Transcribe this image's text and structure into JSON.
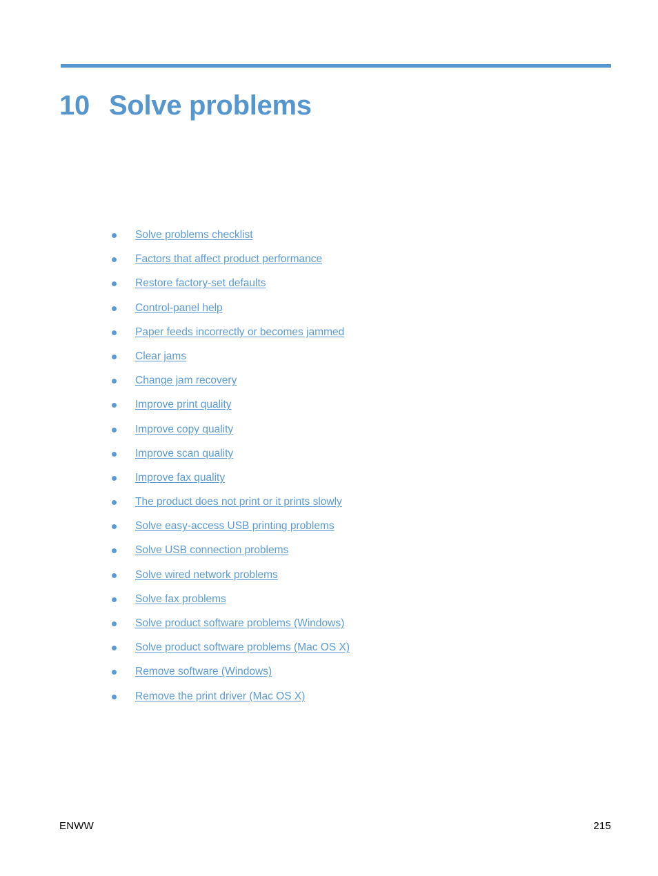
{
  "page": {
    "background_color": "#ffffff",
    "accent_color": "#5496cd",
    "link_color": "#5b9bd5"
  },
  "chapter": {
    "number": "10",
    "title": "Solve problems"
  },
  "toc": {
    "items": [
      {
        "label": "Solve problems checklist"
      },
      {
        "label": "Factors that affect product performance"
      },
      {
        "label": "Restore factory-set defaults"
      },
      {
        "label": "Control-panel help"
      },
      {
        "label": "Paper feeds incorrectly or becomes jammed"
      },
      {
        "label": "Clear jams"
      },
      {
        "label": "Change jam recovery"
      },
      {
        "label": "Improve print quality"
      },
      {
        "label": "Improve copy quality"
      },
      {
        "label": "Improve scan quality"
      },
      {
        "label": "Improve fax quality"
      },
      {
        "label": "The product does not print or it prints slowly"
      },
      {
        "label": "Solve easy-access USB printing problems"
      },
      {
        "label": "Solve USB connection problems"
      },
      {
        "label": "Solve wired network problems"
      },
      {
        "label": "Solve fax problems"
      },
      {
        "label": "Solve product software problems (Windows)"
      },
      {
        "label": "Solve product software problems (Mac OS X)"
      },
      {
        "label": "Remove software (Windows)"
      },
      {
        "label": "Remove the print driver (Mac OS X)"
      }
    ]
  },
  "footer": {
    "left": "ENWW",
    "page_number": "215"
  }
}
